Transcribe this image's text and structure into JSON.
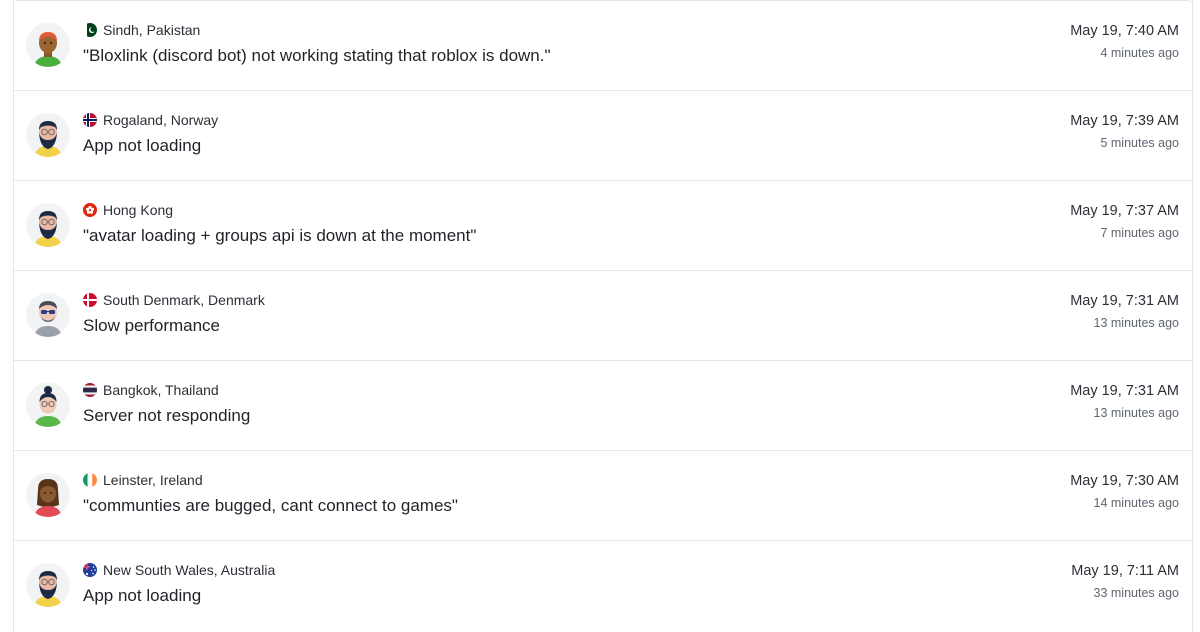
{
  "reports": [
    {
      "location": "Sindh, Pakistan",
      "flag_icon": "pakistan-flag-icon",
      "avatar_icon": "avatar-bald-orange-green-shirt-icon",
      "message": "\"Bloxlink (discord bot) not working stating that roblox is down.\"",
      "time": "May 19, 7:40 AM",
      "ago": "4 minutes ago"
    },
    {
      "location": "Rogaland, Norway",
      "flag_icon": "norway-flag-icon",
      "avatar_icon": "avatar-bearded-glasses-yellow-shirt-icon",
      "message": "App not loading",
      "time": "May 19, 7:39 AM",
      "ago": "5 minutes ago"
    },
    {
      "location": "Hong Kong",
      "flag_icon": "hong-kong-flag-icon",
      "avatar_icon": "avatar-bearded-glasses-yellow-shirt-icon",
      "message": "\"avatar loading + groups api is down at the moment\"",
      "time": "May 19, 7:37 AM",
      "ago": "7 minutes ago"
    },
    {
      "location": "South Denmark, Denmark",
      "flag_icon": "denmark-flag-icon",
      "avatar_icon": "avatar-sunglasses-grey-shirt-icon",
      "message": "Slow performance",
      "time": "May 19, 7:31 AM",
      "ago": "13 minutes ago"
    },
    {
      "location": "Bangkok, Thailand",
      "flag_icon": "thailand-flag-icon",
      "avatar_icon": "avatar-bun-glasses-green-shirt-icon",
      "message": "Server not responding",
      "time": "May 19, 7:31 AM",
      "ago": "13 minutes ago"
    },
    {
      "location": "Leinster, Ireland",
      "flag_icon": "ireland-flag-icon",
      "avatar_icon": "avatar-long-hair-red-shirt-icon",
      "message": "\"communties are bugged, cant connect to games\"",
      "time": "May 19, 7:30 AM",
      "ago": "14 minutes ago"
    },
    {
      "location": "New South Wales, Australia",
      "flag_icon": "australia-flag-icon",
      "avatar_icon": "avatar-bearded-glasses-yellow-shirt-icon",
      "message": "App not loading",
      "time": "May 19, 7:11 AM",
      "ago": "33 minutes ago"
    }
  ]
}
